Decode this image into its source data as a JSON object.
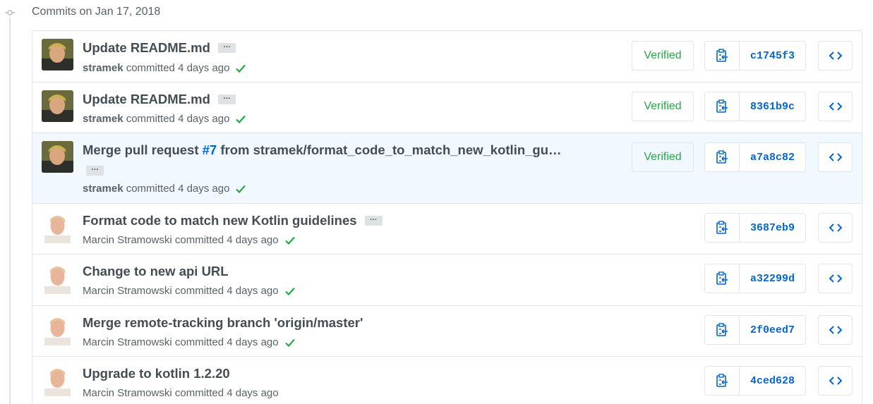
{
  "group": {
    "title": "Commits on Jan 17, 2018"
  },
  "colors": {
    "link": "#0366d6",
    "verified": "#28a745",
    "highlight": "#f1f8ff",
    "border": "#e1e4e8"
  },
  "commits": [
    {
      "title": "Update README.md",
      "author": "stramek",
      "committed": "committed 4 days ago",
      "verified": "Verified",
      "sha": "c1745f3",
      "check": true
    },
    {
      "title": "Update README.md",
      "author": "stramek",
      "committed": "committed 4 days ago",
      "verified": "Verified",
      "sha": "8361b9c",
      "check": true
    },
    {
      "title_prefix": "Merge pull request ",
      "title_link": "#7",
      "title_suffix": " from stramek/format_code_to_match_new_kotlin_gu…",
      "author": "stramek",
      "committed": "committed 4 days ago",
      "verified": "Verified",
      "sha": "a7a8c82",
      "check": true
    },
    {
      "title": "Format code to match new Kotlin guidelines",
      "author": "Marcin Stramowski",
      "committed": "committed 4 days ago",
      "sha": "3687eb9",
      "check": true
    },
    {
      "title": "Change to new api URL",
      "author": "Marcin Stramowski",
      "committed": "committed 4 days ago",
      "sha": "a32299d",
      "check": true
    },
    {
      "title": "Merge remote-tracking branch 'origin/master'",
      "author": "Marcin Stramowski",
      "committed": "committed 4 days ago",
      "sha": "2f0eed7",
      "check": true
    },
    {
      "title": "Upgrade to kotlin 1.2.20",
      "author": "Marcin Stramowski",
      "committed": "committed 4 days ago",
      "sha": "4ced628",
      "check": false
    }
  ],
  "icons": {
    "ellipsis": "…",
    "check": "check-icon",
    "clipboard": "clipboard-icon",
    "code": "code-icon"
  }
}
